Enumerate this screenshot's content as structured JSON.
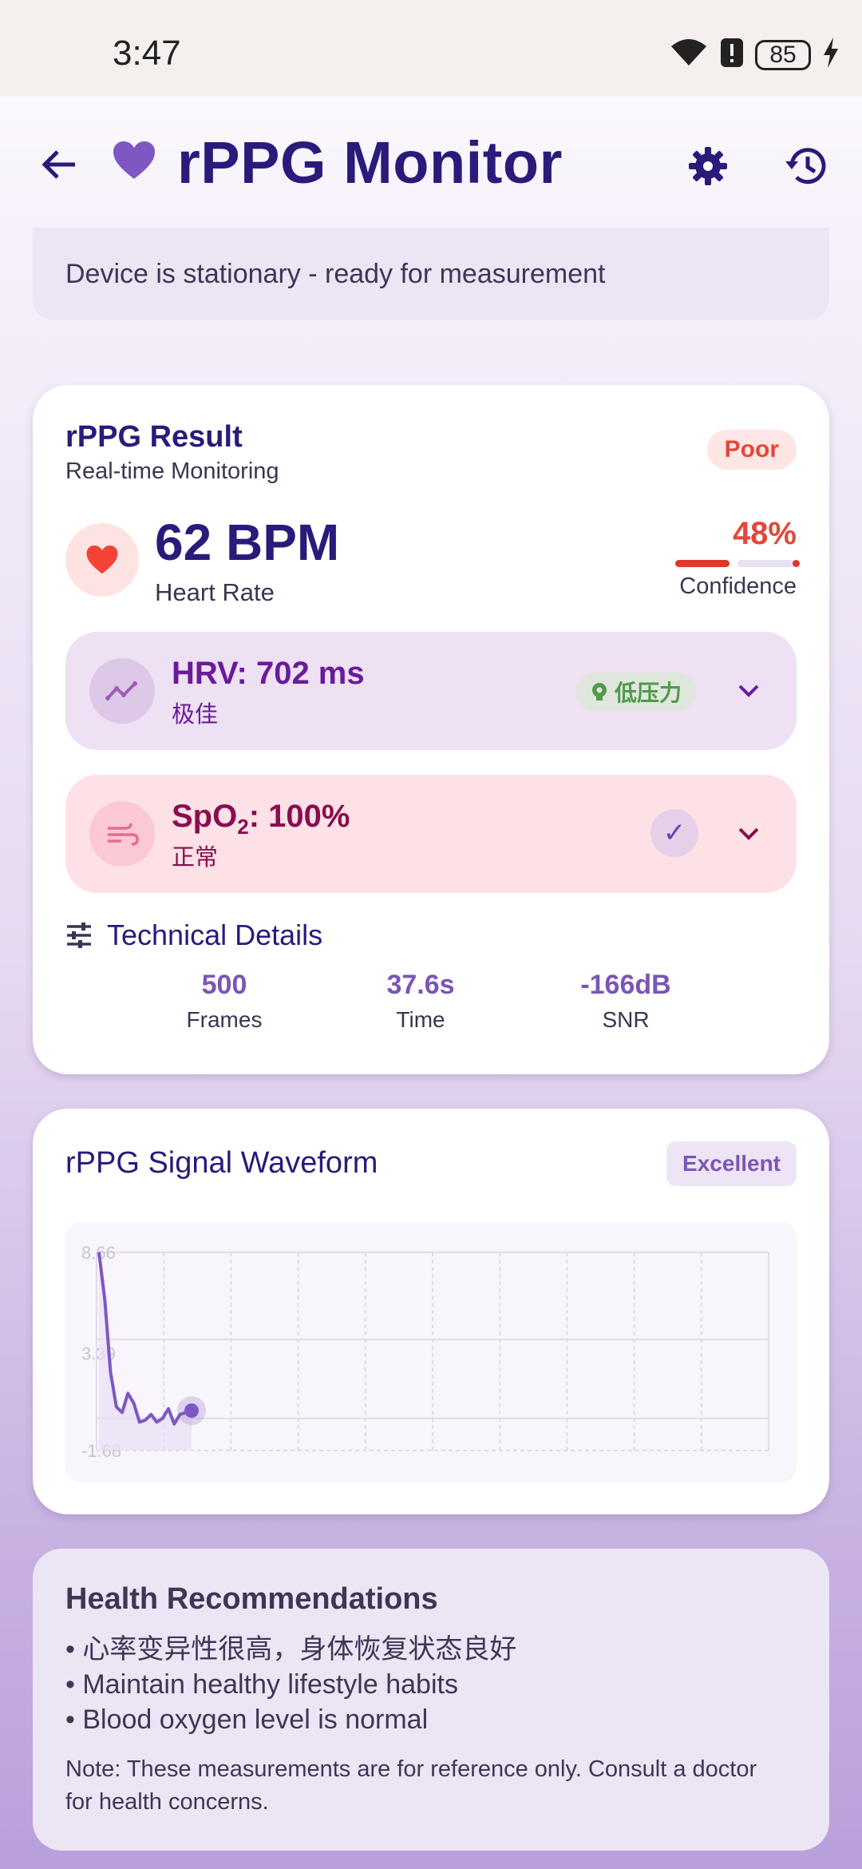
{
  "status": {
    "time": "3:47",
    "battery": "85"
  },
  "app": {
    "title": "rPPG Monitor"
  },
  "banner": {
    "text": "Device is stationary - ready for measurement"
  },
  "result": {
    "title": "rPPG Result",
    "subtitle": "Real-time Monitoring",
    "quality_badge": "Poor",
    "heart_rate": "62 BPM",
    "heart_rate_label": "Heart Rate",
    "confidence": "48%",
    "confidence_fraction": 0.48,
    "confidence_label": "Confidence",
    "hrv": {
      "title": "HRV: 702 ms",
      "status": "极佳",
      "badge": "低压力"
    },
    "spo2": {
      "title_prefix": "SpO",
      "title_sub": "2",
      "title_suffix": ": 100%",
      "status": "正常",
      "check": "✓"
    },
    "technical": {
      "title": "Technical Details",
      "stats": [
        {
          "value": "500",
          "label": "Frames"
        },
        {
          "value": "37.6s",
          "label": "Time"
        },
        {
          "value": "-166dB",
          "label": "SNR"
        }
      ]
    }
  },
  "waveform": {
    "title": "rPPG Signal Waveform",
    "quality_badge": "Excellent"
  },
  "chart_data": {
    "type": "line",
    "title": "",
    "xlabel": "",
    "ylabel": "",
    "y_ticks": [
      "8.66",
      "3.39",
      "-1.68"
    ],
    "ylim": [
      -1.68,
      8.66
    ],
    "x": [
      0,
      1,
      2,
      3,
      4,
      5,
      6,
      7,
      8,
      9,
      10,
      11,
      12,
      13,
      14,
      15,
      16
    ],
    "series": [
      {
        "values": [
          8.66,
          6.2,
          2.4,
          0.6,
          0.3,
          1.3,
          0.8,
          -0.2,
          -0.1,
          0.2,
          -0.2,
          0.0,
          0.5,
          -0.3,
          0.2,
          0.3,
          0.4
        ]
      }
    ],
    "grid": true,
    "colors": {
      "line": "#7e57c2",
      "fill": "#e8dff3"
    }
  },
  "recommendations": {
    "title": "Health Recommendations",
    "items": [
      "• 心率变异性很高，身体恢复状态良好",
      "• Maintain healthy lifestyle habits",
      "• Blood oxygen level is normal"
    ],
    "note": "Note: These measurements are for reference only. Consult a doctor for health concerns."
  },
  "colors": {
    "primary": "#2a1a7a",
    "accent": "#7c55b5",
    "danger": "#e2483a",
    "heart": "#f44336",
    "success": "#4f9a4b"
  }
}
